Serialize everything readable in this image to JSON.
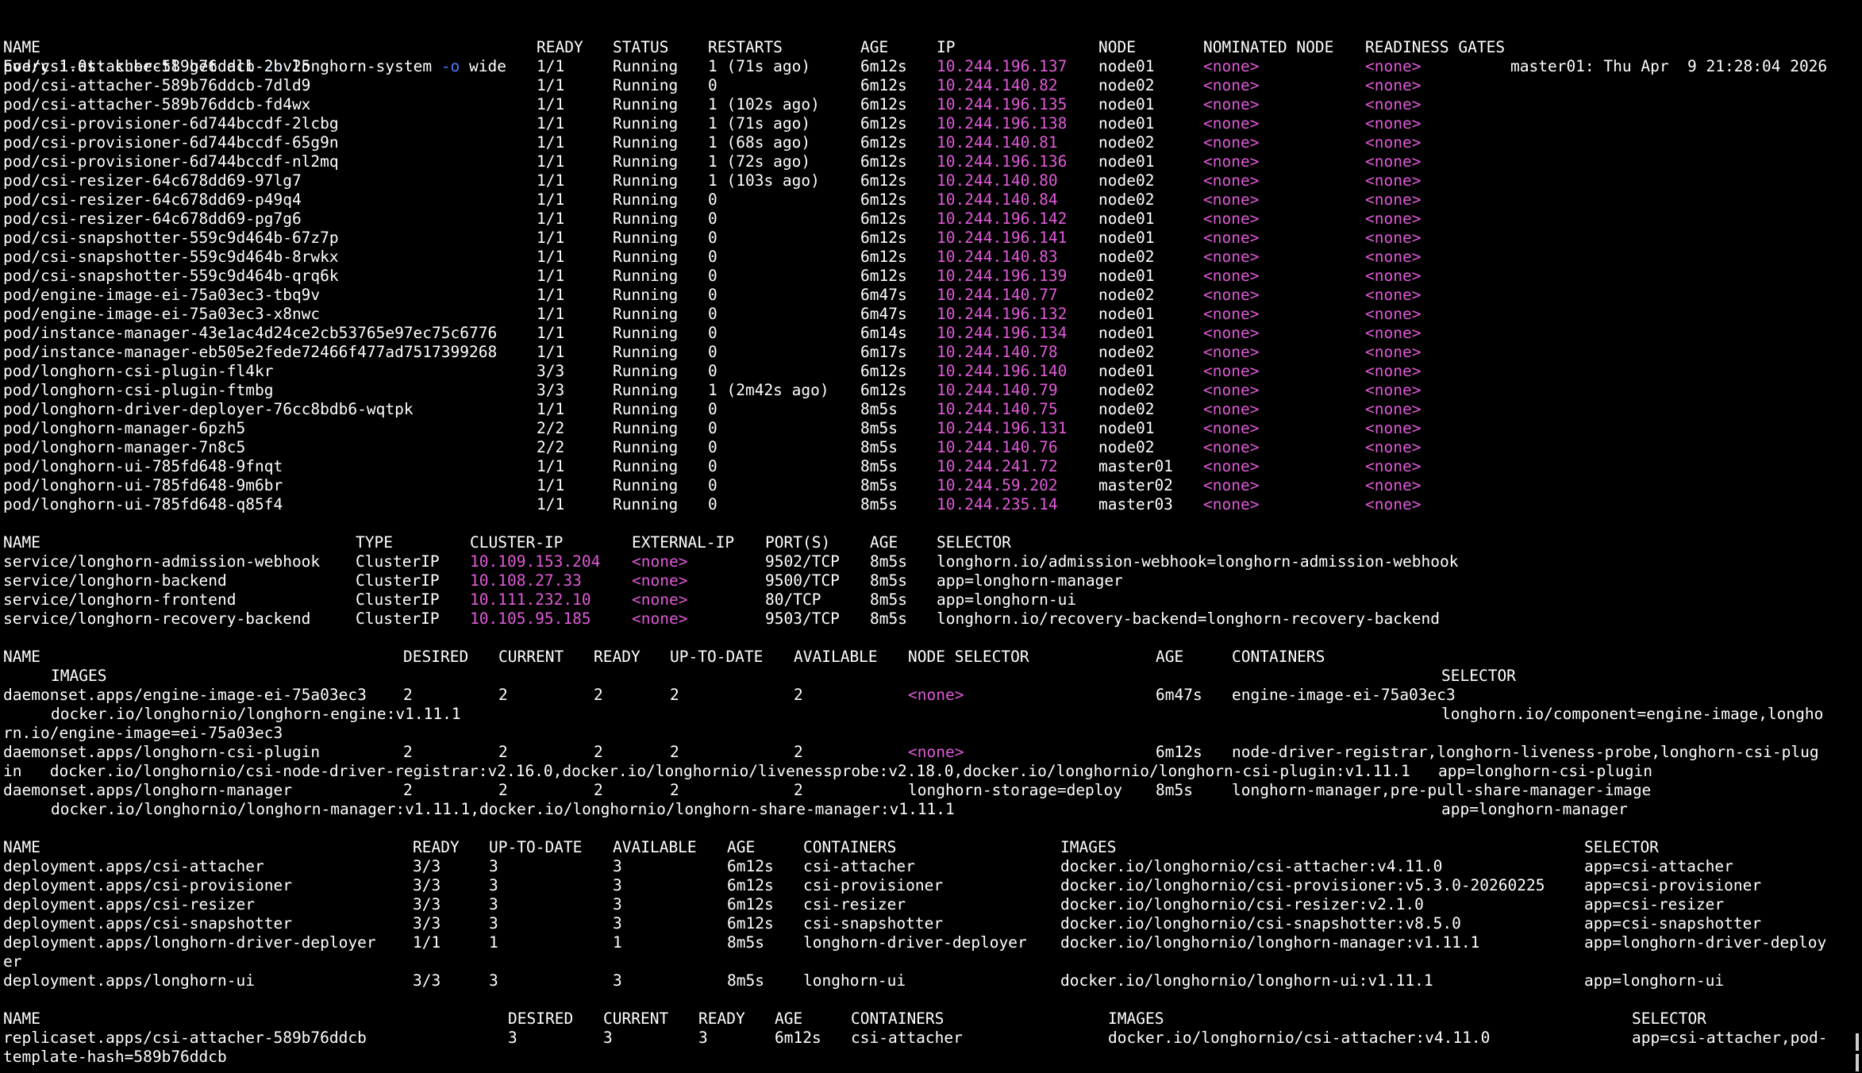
{
  "header": {
    "left_prefix": "Every 1.0s: kubectl get all ",
    "flag_n": "-n",
    "namespace": " longhorn-system ",
    "flag_o": "-o",
    "output": " wide",
    "right": "master01: Thu Apr  9 21:28:04 2026"
  },
  "colors": {
    "ip": "#e05ad8",
    "flag": "#4b7bff",
    "fg": "#ffffff",
    "bg": "#000000"
  },
  "pods": {
    "headers": [
      "NAME",
      "READY",
      "STATUS",
      "RESTARTS",
      "AGE",
      "IP",
      "NODE",
      "NOMINATED NODE",
      "READINESS GATES"
    ],
    "rows": [
      [
        "pod/csi-attacher-589b76ddcb-2bv25",
        "1/1",
        "Running",
        "1 (71s ago)",
        "6m12s",
        "10.244.196.137",
        "node01",
        "<none>",
        "<none>"
      ],
      [
        "pod/csi-attacher-589b76ddcb-7dld9",
        "1/1",
        "Running",
        "0",
        "6m12s",
        "10.244.140.82",
        "node02",
        "<none>",
        "<none>"
      ],
      [
        "pod/csi-attacher-589b76ddcb-fd4wx",
        "1/1",
        "Running",
        "1 (102s ago)",
        "6m12s",
        "10.244.196.135",
        "node01",
        "<none>",
        "<none>"
      ],
      [
        "pod/csi-provisioner-6d744bccdf-2lcbg",
        "1/1",
        "Running",
        "1 (71s ago)",
        "6m12s",
        "10.244.196.138",
        "node01",
        "<none>",
        "<none>"
      ],
      [
        "pod/csi-provisioner-6d744bccdf-65g9n",
        "1/1",
        "Running",
        "1 (68s ago)",
        "6m12s",
        "10.244.140.81",
        "node02",
        "<none>",
        "<none>"
      ],
      [
        "pod/csi-provisioner-6d744bccdf-nl2mq",
        "1/1",
        "Running",
        "1 (72s ago)",
        "6m12s",
        "10.244.196.136",
        "node01",
        "<none>",
        "<none>"
      ],
      [
        "pod/csi-resizer-64c678dd69-97lg7",
        "1/1",
        "Running",
        "1 (103s ago)",
        "6m12s",
        "10.244.140.80",
        "node02",
        "<none>",
        "<none>"
      ],
      [
        "pod/csi-resizer-64c678dd69-p49q4",
        "1/1",
        "Running",
        "0",
        "6m12s",
        "10.244.140.84",
        "node02",
        "<none>",
        "<none>"
      ],
      [
        "pod/csi-resizer-64c678dd69-pg7g6",
        "1/1",
        "Running",
        "0",
        "6m12s",
        "10.244.196.142",
        "node01",
        "<none>",
        "<none>"
      ],
      [
        "pod/csi-snapshotter-559c9d464b-67z7p",
        "1/1",
        "Running",
        "0",
        "6m12s",
        "10.244.196.141",
        "node01",
        "<none>",
        "<none>"
      ],
      [
        "pod/csi-snapshotter-559c9d464b-8rwkx",
        "1/1",
        "Running",
        "0",
        "6m12s",
        "10.244.140.83",
        "node02",
        "<none>",
        "<none>"
      ],
      [
        "pod/csi-snapshotter-559c9d464b-qrq6k",
        "1/1",
        "Running",
        "0",
        "6m12s",
        "10.244.196.139",
        "node01",
        "<none>",
        "<none>"
      ],
      [
        "pod/engine-image-ei-75a03ec3-tbq9v",
        "1/1",
        "Running",
        "0",
        "6m47s",
        "10.244.140.77",
        "node02",
        "<none>",
        "<none>"
      ],
      [
        "pod/engine-image-ei-75a03ec3-x8nwc",
        "1/1",
        "Running",
        "0",
        "6m47s",
        "10.244.196.132",
        "node01",
        "<none>",
        "<none>"
      ],
      [
        "pod/instance-manager-43e1ac4d24ce2cb53765e97ec75c6776",
        "1/1",
        "Running",
        "0",
        "6m14s",
        "10.244.196.134",
        "node01",
        "<none>",
        "<none>"
      ],
      [
        "pod/instance-manager-eb505e2fede72466f477ad7517399268",
        "1/1",
        "Running",
        "0",
        "6m17s",
        "10.244.140.78",
        "node02",
        "<none>",
        "<none>"
      ],
      [
        "pod/longhorn-csi-plugin-fl4kr",
        "3/3",
        "Running",
        "0",
        "6m12s",
        "10.244.196.140",
        "node01",
        "<none>",
        "<none>"
      ],
      [
        "pod/longhorn-csi-plugin-ftmbg",
        "3/3",
        "Running",
        "1 (2m42s ago)",
        "6m12s",
        "10.244.140.79",
        "node02",
        "<none>",
        "<none>"
      ],
      [
        "pod/longhorn-driver-deployer-76cc8bdb6-wqtpk",
        "1/1",
        "Running",
        "0",
        "8m5s",
        "10.244.140.75",
        "node02",
        "<none>",
        "<none>"
      ],
      [
        "pod/longhorn-manager-6pzh5",
        "2/2",
        "Running",
        "0",
        "8m5s",
        "10.244.196.131",
        "node01",
        "<none>",
        "<none>"
      ],
      [
        "pod/longhorn-manager-7n8c5",
        "2/2",
        "Running",
        "0",
        "8m5s",
        "10.244.140.76",
        "node02",
        "<none>",
        "<none>"
      ],
      [
        "pod/longhorn-ui-785fd648-9fnqt",
        "1/1",
        "Running",
        "0",
        "8m5s",
        "10.244.241.72",
        "master01",
        "<none>",
        "<none>"
      ],
      [
        "pod/longhorn-ui-785fd648-9m6br",
        "1/1",
        "Running",
        "0",
        "8m5s",
        "10.244.59.202",
        "master02",
        "<none>",
        "<none>"
      ],
      [
        "pod/longhorn-ui-785fd648-q85f4",
        "1/1",
        "Running",
        "0",
        "8m5s",
        "10.244.235.14",
        "master03",
        "<none>",
        "<none>"
      ]
    ]
  },
  "services": {
    "headers": [
      "NAME",
      "TYPE",
      "CLUSTER-IP",
      "EXTERNAL-IP",
      "PORT(S)",
      "AGE",
      "SELECTOR"
    ],
    "rows": [
      [
        "service/longhorn-admission-webhook",
        "ClusterIP",
        "10.109.153.204",
        "<none>",
        "9502/TCP",
        "8m5s",
        "longhorn.io/admission-webhook=longhorn-admission-webhook"
      ],
      [
        "service/longhorn-backend",
        "ClusterIP",
        "10.108.27.33",
        "<none>",
        "9500/TCP",
        "8m5s",
        "app=longhorn-manager"
      ],
      [
        "service/longhorn-frontend",
        "ClusterIP",
        "10.111.232.10",
        "<none>",
        "80/TCP",
        "8m5s",
        "app=longhorn-ui"
      ],
      [
        "service/longhorn-recovery-backend",
        "ClusterIP",
        "10.105.95.185",
        "<none>",
        "9503/TCP",
        "8m5s",
        "longhorn.io/recovery-backend=longhorn-recovery-backend"
      ]
    ]
  },
  "daemonsets": {
    "headers": [
      "NAME",
      "DESIRED",
      "CURRENT",
      "READY",
      "UP-TO-DATE",
      "AVAILABLE",
      "NODE SELECTOR",
      "AGE",
      "CONTAINERS",
      "IMAGES",
      "SELECTOR"
    ],
    "rows": [
      {
        "name": "daemonset.apps/engine-image-ei-75a03ec3",
        "desired": "2",
        "current": "2",
        "ready": "2",
        "uptodate": "2",
        "available": "2",
        "node_selector": "<none>",
        "age": "6m47s",
        "containers": "engine-image-ei-75a03ec3",
        "images": "docker.io/longhornio/longhorn-engine:v1.11.1",
        "selector_a": "longhorn.io/component=engine-image,longho",
        "selector_b": "rn.io/engine-image=ei-75a03ec3"
      },
      {
        "name": "daemonset.apps/longhorn-csi-plugin",
        "desired": "2",
        "current": "2",
        "ready": "2",
        "uptodate": "2",
        "available": "2",
        "node_selector": "<none>",
        "age": "6m12s",
        "containers_a": "node-driver-registrar,longhorn-liveness-probe,longhorn-csi-plug",
        "images_line": "in   docker.io/longhornio/csi-node-driver-registrar:v2.16.0,docker.io/longhornio/livenessprobe:v2.18.0,docker.io/longhornio/longhorn-csi-plugin:v1.11.1   app=longhorn-csi-plugin"
      },
      {
        "name": "daemonset.apps/longhorn-manager",
        "desired": "2",
        "current": "2",
        "ready": "2",
        "uptodate": "2",
        "available": "2",
        "node_selector": "longhorn-storage=deploy",
        "age": "8m5s",
        "containers": "longhorn-manager,pre-pull-share-manager-image",
        "images": "docker.io/longhornio/longhorn-manager:v1.11.1,docker.io/longhornio/longhorn-share-manager:v1.11.1",
        "selector": "app=longhorn-manager"
      }
    ]
  },
  "deployments": {
    "headers": [
      "NAME",
      "READY",
      "UP-TO-DATE",
      "AVAILABLE",
      "AGE",
      "CONTAINERS",
      "IMAGES",
      "SELECTOR"
    ],
    "rows": [
      [
        "deployment.apps/csi-attacher",
        "3/3",
        "3",
        "3",
        "6m12s",
        "csi-attacher",
        "docker.io/longhornio/csi-attacher:v4.11.0",
        "app=csi-attacher"
      ],
      [
        "deployment.apps/csi-provisioner",
        "3/3",
        "3",
        "3",
        "6m12s",
        "csi-provisioner",
        "docker.io/longhornio/csi-provisioner:v5.3.0-20260225",
        "app=csi-provisioner"
      ],
      [
        "deployment.apps/csi-resizer",
        "3/3",
        "3",
        "3",
        "6m12s",
        "csi-resizer",
        "docker.io/longhornio/csi-resizer:v2.1.0",
        "app=csi-resizer"
      ],
      [
        "deployment.apps/csi-snapshotter",
        "3/3",
        "3",
        "3",
        "6m12s",
        "csi-snapshotter",
        "docker.io/longhornio/csi-snapshotter:v8.5.0",
        "app=csi-snapshotter"
      ],
      [
        "deployment.apps/longhorn-driver-deployer",
        "1/1",
        "1",
        "1",
        "8m5s",
        "longhorn-driver-deployer",
        "docker.io/longhornio/longhorn-manager:v1.11.1",
        "app=longhorn-driver-deploy"
      ],
      [
        "deployment.apps/longhorn-ui",
        "3/3",
        "3",
        "3",
        "8m5s",
        "longhorn-ui",
        "docker.io/longhornio/longhorn-ui:v1.11.1",
        "app=longhorn-ui"
      ]
    ],
    "wrap_er": "er"
  },
  "replicasets": {
    "headers": [
      "NAME",
      "DESIRED",
      "CURRENT",
      "READY",
      "AGE",
      "CONTAINERS",
      "IMAGES",
      "SELECTOR"
    ],
    "rows": [
      [
        "replicaset.apps/csi-attacher-589b76ddcb",
        "3",
        "3",
        "3",
        "6m12s",
        "csi-attacher",
        "docker.io/longhornio/csi-attacher:v4.11.0",
        "app=csi-attacher,pod-"
      ]
    ],
    "wrap": "template-hash=589b76ddcb"
  }
}
